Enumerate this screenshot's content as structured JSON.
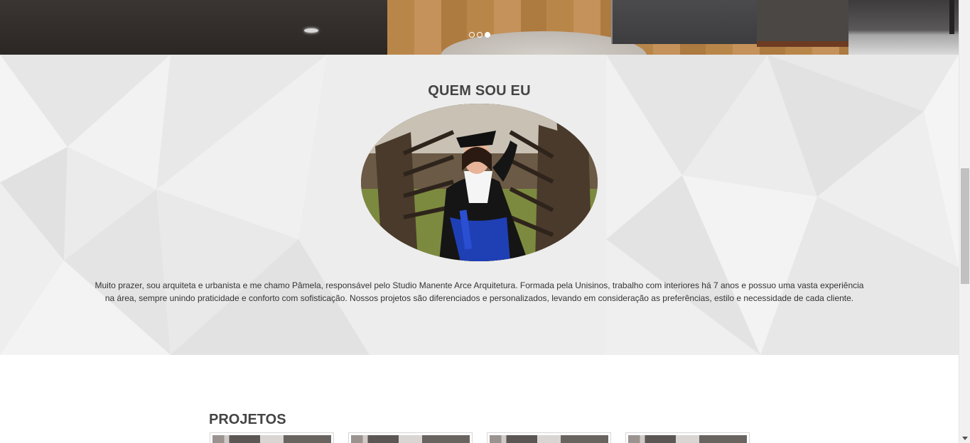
{
  "hero": {
    "slides": [
      {
        "label": "",
        "active": false
      },
      {
        "label": "",
        "active": false
      },
      {
        "label": "",
        "active": true
      }
    ]
  },
  "about": {
    "title": "QUEM SOU EU",
    "portrait_icon": "person-portrait-icon",
    "text": "Muito prazer, sou arquiteta e urbanista e me chamo Pâmela, responsável pelo Studio Manente Arce Arquitetura. Formada pela Unisinos, trabalho com interiores há 7 anos e possuo uma vasta experiência na área, sempre unindo praticidade e conforto com sofisticação. Nossos projetos são diferenciados e personalizados, levando em consideração as preferências, estilo e necessidade de cada cliente."
  },
  "projects": {
    "title": "PROJETOS",
    "items": [
      {
        "label": ""
      },
      {
        "label": ""
      },
      {
        "label": ""
      },
      {
        "label": ""
      }
    ]
  },
  "colors": {
    "heading": "#444444",
    "body_text": "#333333",
    "section_bg": "#ececec"
  }
}
